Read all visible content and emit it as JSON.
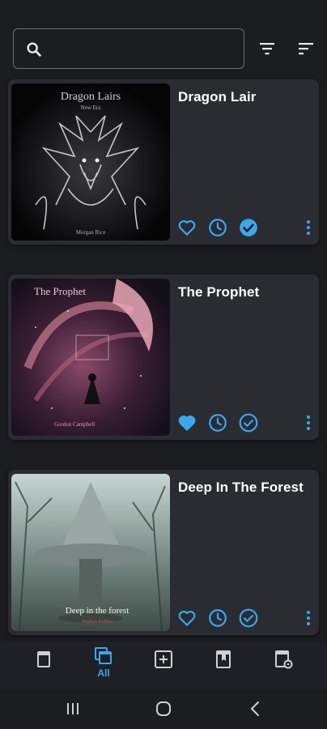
{
  "search": {
    "placeholder": "",
    "value": ""
  },
  "books": [
    {
      "title": "Dragon Lair",
      "cover_title": "Dragon Lairs",
      "cover_subtitle": "New Era",
      "cover_author": "Morgan Rice",
      "favorite": false,
      "completed": true
    },
    {
      "title": "The Prophet",
      "cover_title": "The Prophet",
      "cover_subtitle": "",
      "cover_author": "Gordon Campbell",
      "favorite": true,
      "completed": false
    },
    {
      "title": "Deep In The Forest",
      "cover_title": "Deep in the forest",
      "cover_subtitle": "",
      "cover_author": "Stephen Kellino",
      "favorite": false,
      "completed": false
    }
  ],
  "bottom_nav": {
    "items": [
      {
        "id": "library",
        "label": ""
      },
      {
        "id": "all",
        "label": "All",
        "active": true
      },
      {
        "id": "add",
        "label": ""
      },
      {
        "id": "reading",
        "label": ""
      },
      {
        "id": "archive",
        "label": ""
      }
    ]
  },
  "colors": {
    "accent": "#39a8ee",
    "background": "#1c1d21",
    "card": "#2a2c32"
  },
  "icons": {
    "search": "search-icon",
    "filter": "filter-icon",
    "sort": "sort-icon",
    "favorite": "heart-icon",
    "history": "clock-icon",
    "done": "check-circle-icon",
    "more": "more-vert-icon"
  }
}
